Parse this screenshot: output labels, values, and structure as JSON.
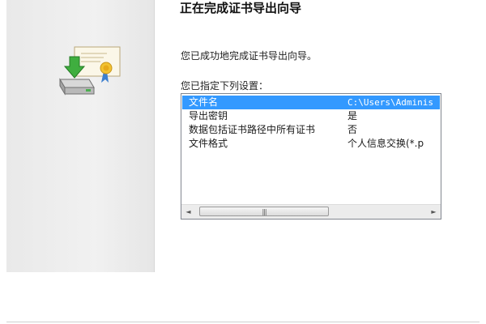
{
  "wizard": {
    "title": "正在完成证书导出向导",
    "success_message": "您已成功地完成证书导出向导。",
    "settings_caption": "您已指定下列设置："
  },
  "settings": [
    {
      "key": "文件名",
      "value": "C:\\Users\\Adminis"
    },
    {
      "key": "导出密钥",
      "value": "是"
    },
    {
      "key": "数据包括证书路径中所有证书",
      "value": "否"
    },
    {
      "key": "文件格式",
      "value": "个人信息交换(*.p"
    }
  ],
  "scrollbar": {
    "left_arrow": "◄",
    "right_arrow": "►",
    "grip": "|||"
  },
  "icons": {
    "wizard_image": "certificate-export-icon"
  },
  "colors": {
    "selection": "#3399ff",
    "panel": "#ececec"
  }
}
